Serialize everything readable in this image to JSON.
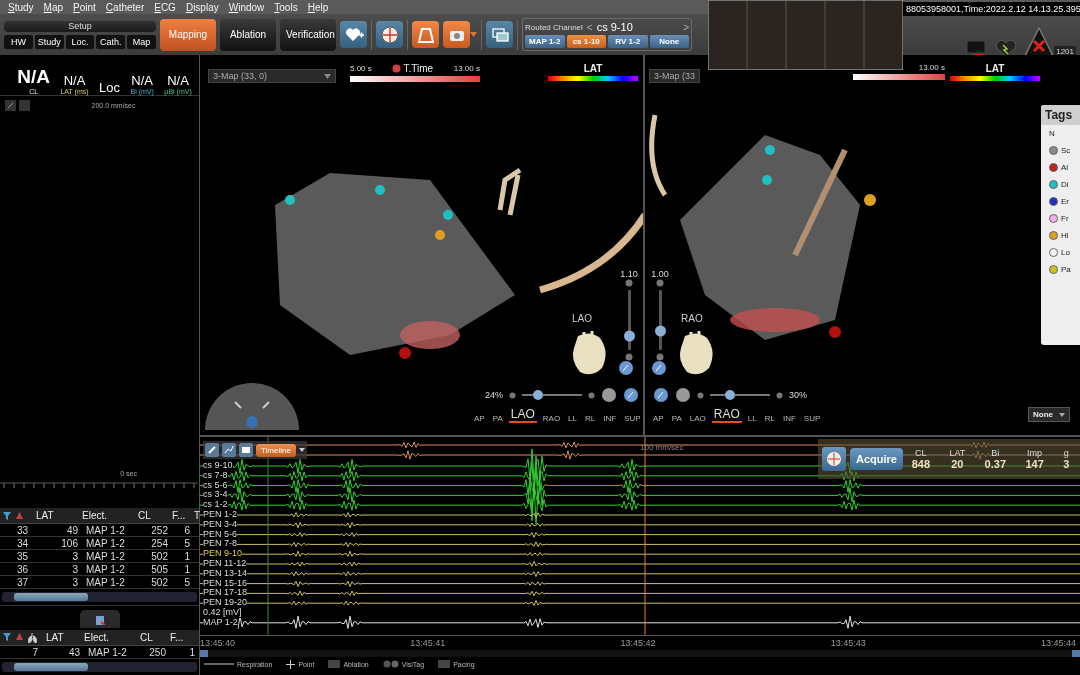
{
  "menu": [
    "Study",
    "Map",
    "Point",
    "Catheter",
    "ECG",
    "Display",
    "Window",
    "Tools",
    "Help"
  ],
  "setup": {
    "title": "Setup",
    "tabs": [
      {
        "label": "HW",
        "selected": false
      },
      {
        "label": "Study",
        "selected": false
      },
      {
        "label": "Loc.",
        "selected": false
      },
      {
        "label": "Cath.",
        "selected": false
      },
      {
        "label": "Map",
        "selected": false
      }
    ]
  },
  "modes": [
    {
      "label": "Mapping",
      "selected": true
    },
    {
      "label": "Ablation",
      "selected": false
    },
    {
      "label": "Verification",
      "selected": false
    }
  ],
  "tools": [
    {
      "on": false
    },
    {
      "on": false
    },
    {
      "on": true
    },
    {
      "on": true
    },
    {
      "on": false
    }
  ],
  "routed_channel": {
    "label": "Routed Channel",
    "prev": "<",
    "value": "cs 9-10",
    "next": ">",
    "options": [
      {
        "label": "MAP 1-2",
        "selected": false
      },
      {
        "label": "cs 1-10",
        "selected": true
      },
      {
        "label": "RV 1-2",
        "selected": false
      },
      {
        "label": "None",
        "selected": false
      }
    ]
  },
  "preview": {
    "caption": "88053958001,Time:2022.2.12 14.13.25.395"
  },
  "status": {
    "alarm_count": "1201"
  },
  "readouts": [
    {
      "value": "N/A",
      "unit": "CL",
      "kind": "large"
    },
    {
      "value": "N/A",
      "unit": "LAT (ms)",
      "kind": "normal"
    },
    {
      "value": "Loc",
      "kind": "normal"
    },
    {
      "value": "N/A",
      "unit": "Bi (mV)",
      "kind": "normal"
    },
    {
      "value": "N/A",
      "unit": "µBi (mV)",
      "kind": "normal"
    }
  ],
  "left_view": {
    "speed": "200.0 mm/sec",
    "time": "0 sec"
  },
  "maps": [
    {
      "title": "3-Map (33, 0)",
      "time_bar": {
        "start": "5.00 s",
        "label": "T.Time",
        "end": "13.00 s"
      },
      "scale_label": "LAT",
      "zoom": {
        "reading": "1.10",
        "level": 0.23
      },
      "view_label": "LAO",
      "opacity": {
        "reading": "24%",
        "level": 0.27
      },
      "views": [
        {
          "label": "AP",
          "selected": false
        },
        {
          "label": "PA",
          "selected": false
        },
        {
          "label": "LAO",
          "selected": true
        },
        {
          "label": "RAO",
          "selected": false
        },
        {
          "label": "LL",
          "selected": false
        },
        {
          "label": "RL",
          "selected": false
        },
        {
          "label": "INF",
          "selected": false
        },
        {
          "label": "SUP",
          "selected": false
        }
      ]
    },
    {
      "title": "3-Map (33",
      "time_bar": {
        "end": "13.00 s"
      },
      "scale_label": "LAT",
      "zoom": {
        "reading": "1.00",
        "level": 0.32
      },
      "view_label": "RAO",
      "opacity": {
        "reading": "30%",
        "level": 0.33
      },
      "views": [
        {
          "label": "AP",
          "selected": false
        },
        {
          "label": "PA",
          "selected": false
        },
        {
          "label": "LAO",
          "selected": false
        },
        {
          "label": "RAO",
          "selected": true
        },
        {
          "label": "LL",
          "selected": false
        },
        {
          "label": "RL",
          "selected": false
        },
        {
          "label": "INF",
          "selected": false
        },
        {
          "label": "SUP",
          "selected": false
        }
      ],
      "tags": {
        "title": "Tags",
        "items": [
          {
            "label": "N"
          },
          {
            "label": "Sc",
            "color": "#8a8a8a"
          },
          {
            "label": "Al",
            "color": "#c02020"
          },
          {
            "label": "Di",
            "color": "#20c0c0"
          },
          {
            "label": "Er",
            "color": "#2030c0"
          },
          {
            "label": "Fr",
            "color": "#f0b0e0"
          },
          {
            "label": "Hi",
            "color": "#e0a020"
          },
          {
            "label": "Lo",
            "color": "#f4f4f4"
          },
          {
            "label": "Pa",
            "color": "#d0c020"
          }
        ]
      },
      "filter": "None"
    }
  ],
  "points_table": {
    "columns": [
      "",
      "LAT",
      "Elect.",
      "CL",
      "F...",
      "T"
    ],
    "rows": [
      {
        "cells": [
          "33",
          "49",
          "MAP 1-2",
          "252",
          "6"
        ]
      },
      {
        "cells": [
          "34",
          "106",
          "MAP 1-2",
          "254",
          "5"
        ]
      },
      {
        "cells": [
          "35",
          "3",
          "MAP 1-2",
          "502",
          "1"
        ]
      },
      {
        "cells": [
          "36",
          "3",
          "MAP 1-2",
          "505",
          "1"
        ]
      },
      {
        "cells": [
          "37",
          "3",
          "MAP 1-2",
          "502",
          "5"
        ]
      }
    ]
  },
  "tag_table": {
    "columns": [
      "",
      "LAT",
      "Elect.",
      "CL",
      "F..."
    ],
    "rows": [
      {
        "cells": [
          "7",
          "43",
          "MAP 1-2",
          "250",
          "1"
        ]
      }
    ]
  },
  "ecg": {
    "timeline": "Timeline",
    "speed": "100 mm/sec",
    "scale_label": "0.42 [mV]",
    "channels": [
      {
        "color": "#d89060"
      },
      {
        "color": "#d89060"
      },
      {
        "name": "cs 9-10",
        "color": "#30d030",
        "selected": false
      },
      {
        "name": "cs 7-8",
        "color": "#30d030",
        "selected": false
      },
      {
        "name": "cs 5-6",
        "color": "#30d030",
        "selected": false
      },
      {
        "name": "cs 3-4",
        "color": "#30d030",
        "selected": false
      },
      {
        "name": "cs 1-2",
        "color": "#30d030",
        "selected": false
      },
      {
        "name": "PEN 1-2",
        "color": "#c8c060",
        "selected": false
      },
      {
        "name": "PEN 3-4",
        "color": "#c8c060",
        "selected": false
      },
      {
        "name": "PEN 5-6",
        "color": "#c8c060",
        "selected": false
      },
      {
        "name": "PEN 7-8",
        "color": "#c8c060",
        "selected": false
      },
      {
        "name": "PEN 9-10",
        "color": "#c8c060",
        "selected": true
      },
      {
        "name": "PEN 11-12",
        "color": "#c8c060",
        "selected": false
      },
      {
        "name": "PEN 13-14",
        "color": "#c8c060",
        "selected": false
      },
      {
        "name": "PEN 15-16",
        "color": "#c8c060",
        "selected": false
      },
      {
        "name": "PEN 17-18",
        "color": "#c8c060",
        "selected": false
      },
      {
        "name": "PEN 19-20",
        "color": "#c8c060",
        "selected": false
      },
      {
        "name": "MAP 1-2",
        "color": "#e0e0e0",
        "selected": false
      }
    ],
    "times": [
      "13:45:40",
      "13:45:41",
      "13:45:42",
      "13:45:43",
      "13:45:44"
    ],
    "legend": [
      {
        "label": "Respiration",
        "kind": "line"
      },
      {
        "label": "Point",
        "kind": "cross"
      },
      {
        "label": "Ablation",
        "kind": "box"
      },
      {
        "label": "VisiTag",
        "kind": "rings"
      },
      {
        "label": "Pacing",
        "kind": "box"
      }
    ]
  },
  "acquire": {
    "button": "Acquire",
    "columns": [
      "CL",
      "LAT",
      "Bi",
      "Imp",
      "g"
    ],
    "values": [
      "848",
      "20",
      "0.37",
      "147",
      "3"
    ]
  }
}
